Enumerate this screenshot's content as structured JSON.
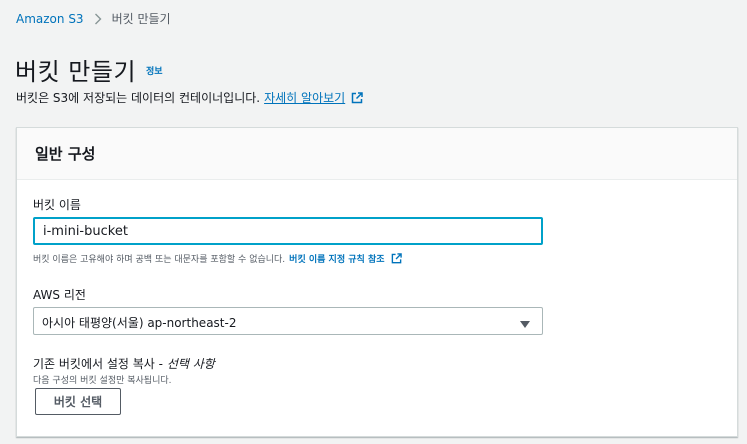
{
  "breadcrumb": {
    "root": "Amazon S3",
    "current": "버킷 만들기"
  },
  "header": {
    "title": "버킷 만들기",
    "info": "정보",
    "description": "버킷은 S3에 저장되는 데이터의 컨테이너입니다.",
    "learn_more": "자세히 알아보기"
  },
  "panel": {
    "title": "일반 구성",
    "bucket_name": {
      "label": "버킷 이름",
      "value": "i-mini-bucket",
      "hint": "버킷 이름은 고유해야 하며 공백 또는 대문자를 포함할 수 없습니다.",
      "rules_link": "버킷 이름 지정 규칙 참조"
    },
    "region": {
      "label": "AWS 리전",
      "selected": "아시아 태평양(서울) ap-northeast-2"
    },
    "copy_settings": {
      "label": "기존 버킷에서 설정 복사 - ",
      "optional": "선택 사항",
      "hint": "다음 구성의 버킷 설정만 복사됩니다.",
      "button": "버킷 선택"
    }
  },
  "colors": {
    "link": "#0073bb",
    "focus": "#00a1c9",
    "background": "#f2f3f3"
  },
  "icons": [
    "chevron-right-icon",
    "external-link-icon",
    "caret-down-icon"
  ]
}
